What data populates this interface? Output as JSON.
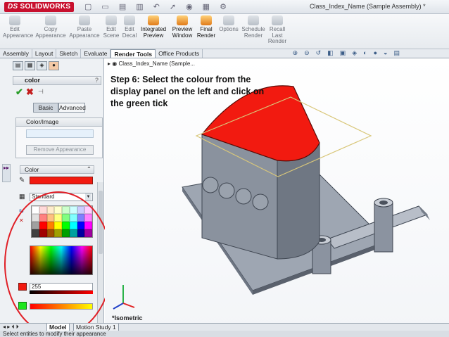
{
  "titlebar": {
    "logo": "SOLIDWORKS",
    "logo_prefix": "DS",
    "window_title": "Class_Index_Name (Sample Assembly) *"
  },
  "ribbon": {
    "buttons": [
      {
        "label": "Edit Appearance"
      },
      {
        "label": "Copy Appearance"
      },
      {
        "label": "Paste Appearance"
      },
      {
        "label": "Edit Scene"
      },
      {
        "label": "Edit Decal"
      },
      {
        "label": "Integrated Preview"
      },
      {
        "label": "Preview Window"
      },
      {
        "label": "Final Render"
      },
      {
        "label": "Options"
      },
      {
        "label": "Schedule Render"
      },
      {
        "label": "Recall Last Render"
      }
    ]
  },
  "tabs": [
    "Assembly",
    "Layout",
    "Sketch",
    "Evaluate",
    "Render Tools",
    "Office Products"
  ],
  "active_tab": "Render Tools",
  "panel": {
    "title": "color",
    "help": "?",
    "mode_basic": "Basic",
    "mode_advanced": "Advanced",
    "color_image_header": "Color/Image",
    "remove_button": "Remove Appearance",
    "color_header": "Color",
    "palette_select": "Standard",
    "red_value": "255",
    "selected_color": "#f21a10"
  },
  "tree_item": "Class_Index_Name (Sample...",
  "caption": "Step 6: Select the colour from the display panel on the left and click on the green tick",
  "view_label": "*Isometric",
  "bottom_tabs": {
    "model": "Model",
    "motion": "Motion Study 1"
  },
  "status": "Select entities to modify their appearance"
}
